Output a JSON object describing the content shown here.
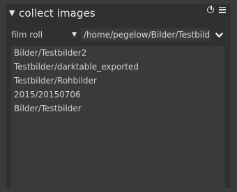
{
  "module": {
    "title": "collect images",
    "collapse_icon": "triangle-down-icon",
    "reset_icon": "reset-icon",
    "presets_icon": "presets-menu-icon"
  },
  "filter": {
    "property": "film roll",
    "path_value": "/home/pegelow/Bilder/Testbilder",
    "dropdown_icon": "chevron-down-icon"
  },
  "results": [
    "Bilder/Testbilder2",
    "Testbilder/darktable_exported",
    "Testbilder/Rohbilder",
    "2015/20150706",
    "Bilder/Testbilder"
  ]
}
